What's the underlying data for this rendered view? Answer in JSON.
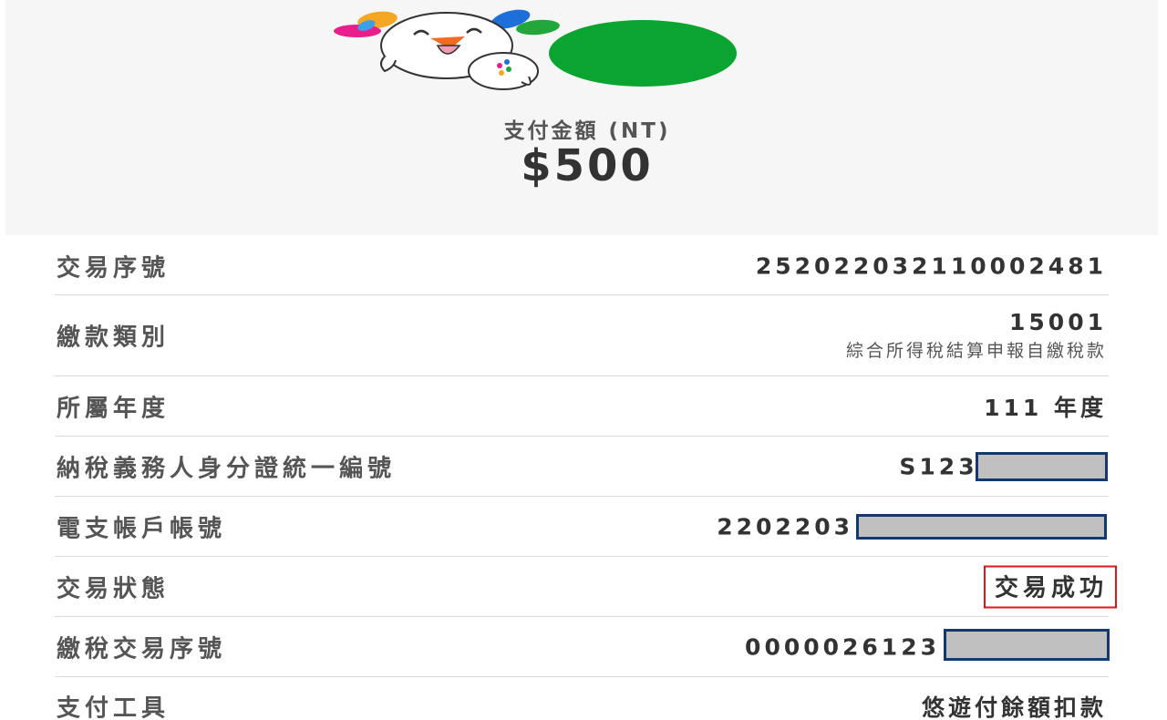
{
  "payment": {
    "amount_label": "支付金額 (NT)",
    "amount_value": "$500"
  },
  "details": [
    {
      "label": "交易序號",
      "value": "252022032110002481"
    },
    {
      "label": "繳款類別",
      "value": "15001",
      "sub_value": "綜合所得稅結算申報自繳稅款"
    },
    {
      "label": "所屬年度",
      "value": "111 年度"
    },
    {
      "label": "納稅義務人身分證統一編號",
      "value": "S1236",
      "redacted": true
    },
    {
      "label": "電支帳戶帳號",
      "value": "2202203",
      "redacted": true
    },
    {
      "label": "交易狀態",
      "value": "交易成功"
    },
    {
      "label": "繳稅交易序號",
      "value": "0000026123",
      "redacted": true
    },
    {
      "label": "支付工具",
      "value": "悠遊付餘額扣款"
    }
  ],
  "colors": {
    "status_highlight": "#e0141e",
    "redaction_border": "#123a6e",
    "redaction_fill": "#c0c0c0",
    "brand_green": "#0aa530"
  },
  "icons": {
    "mascot": "easywallet-mascot-icon"
  }
}
